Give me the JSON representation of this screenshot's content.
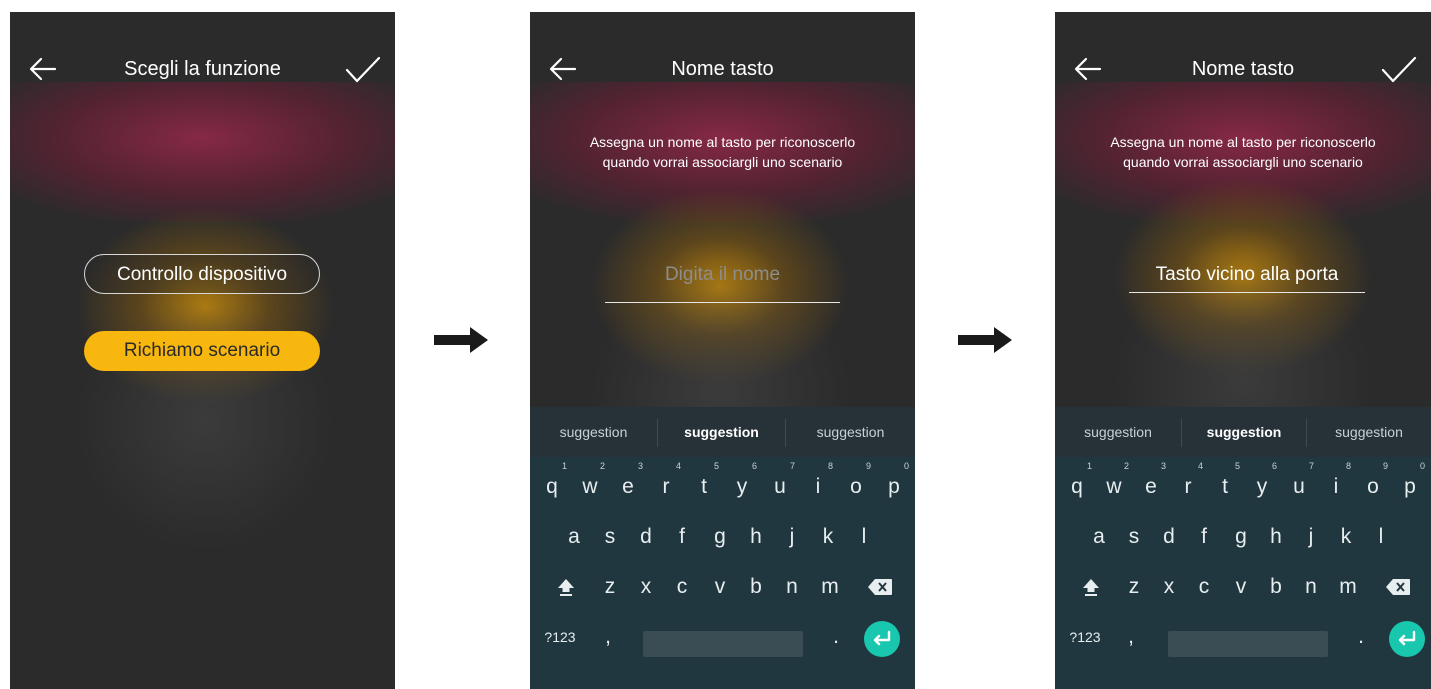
{
  "screen1": {
    "title": "Scegli la funzione",
    "back_icon": "arrow-left-icon",
    "confirm_icon": "check-icon",
    "options": [
      "Controllo dispositivo",
      "Richiamo scenario"
    ]
  },
  "screen2": {
    "title": "Nome tasto",
    "back_icon": "arrow-left-icon",
    "description_line1": "Assegna un nome al tasto per riconoscerlo",
    "description_line2": "quando vorrai associargli uno scenario",
    "input_placeholder": "Digita il nome",
    "input_value": ""
  },
  "screen3": {
    "title": "Nome tasto",
    "back_icon": "arrow-left-icon",
    "confirm_icon": "check-icon",
    "description_line1": "Assegna un nome al tasto per riconoscerlo",
    "description_line2": "quando vorrai associargli uno scenario",
    "input_value": "Tasto vicino alla porta"
  },
  "keyboard": {
    "suggestions": [
      "suggestion",
      "suggestion",
      "suggestion"
    ],
    "row1": [
      "q",
      "w",
      "e",
      "r",
      "t",
      "y",
      "u",
      "i",
      "o",
      "p"
    ],
    "row1_hints": [
      "1",
      "2",
      "3",
      "4",
      "5",
      "6",
      "7",
      "8",
      "9",
      "0"
    ],
    "row2": [
      "a",
      "s",
      "d",
      "f",
      "g",
      "h",
      "j",
      "k",
      "l"
    ],
    "row3": [
      "z",
      "x",
      "c",
      "v",
      "b",
      "n",
      "m"
    ],
    "symbols_label": "?123",
    "comma": ",",
    "period": ".",
    "shift_icon": "shift-icon",
    "backspace_icon": "backspace-icon",
    "enter_icon": "enter-icon"
  },
  "colors": {
    "screen_bg": "#2b2b2b",
    "accent_yellow": "#f8b70e",
    "keyboard_bg": "#21373f",
    "suggestion_bg": "#263238",
    "enter_teal": "#19c6ae"
  },
  "flow_arrows": [
    "arrow-right-icon",
    "arrow-right-icon"
  ]
}
